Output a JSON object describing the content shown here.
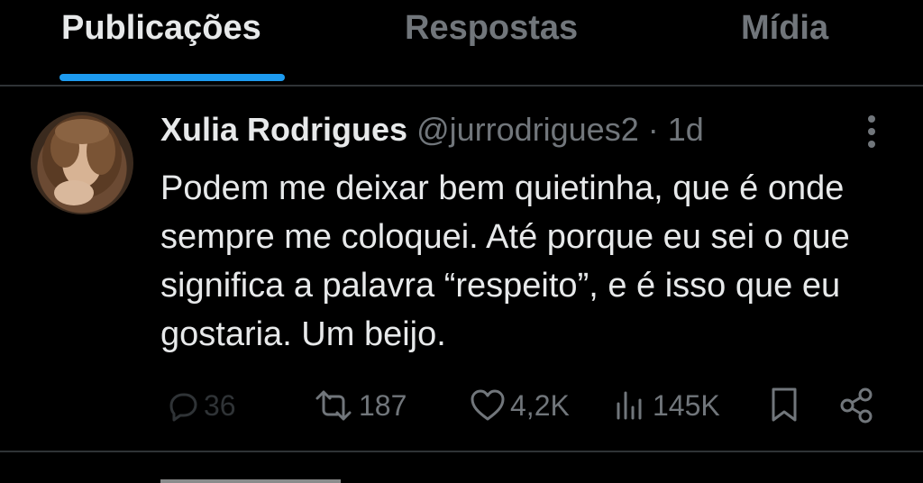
{
  "tabs": [
    {
      "label": "Publicações",
      "active": true
    },
    {
      "label": "Respostas",
      "active": false
    },
    {
      "label": "Mídia",
      "active": false
    }
  ],
  "post": {
    "author_name": "Xulia Rodrigues",
    "author_handle": "@jurrodrigues2",
    "separator": "·",
    "time": "1d",
    "text": "Podem me deixar bem quietinha, que é onde sempre me coloquei. Até porque eu sei o que significa a palavra “respeito”, e é isso que eu gostaria. Um beijo.",
    "actions": {
      "replies": "36",
      "reposts": "187",
      "likes": "4,2K",
      "views": "145K"
    }
  },
  "colors": {
    "background": "#000000",
    "text_primary": "#e7e9ea",
    "text_secondary": "#71767b",
    "accent": "#1d9bf0",
    "divider": "#2f3336"
  },
  "icons": [
    "more-vertical-icon",
    "reply-icon",
    "repost-icon",
    "like-icon",
    "views-icon",
    "bookmark-icon",
    "share-icon"
  ]
}
